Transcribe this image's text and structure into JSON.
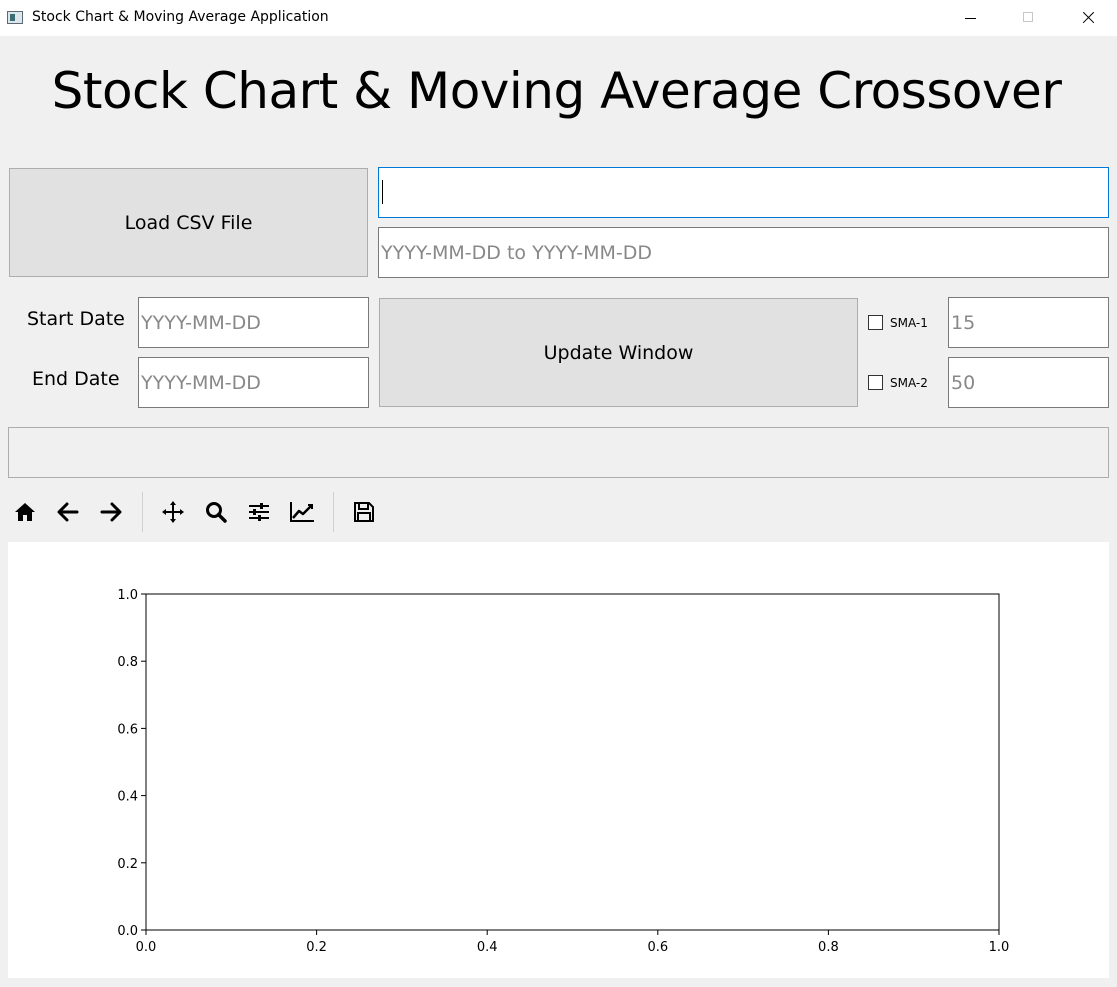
{
  "window": {
    "title": "Stock Chart & Moving Average Application"
  },
  "heading": "Stock Chart & Moving Average Crossover",
  "load_button_label": "Load CSV File",
  "file_path_input": {
    "value": "",
    "placeholder": ""
  },
  "date_range_input": {
    "value": "",
    "placeholder": "YYYY-MM-DD to YYYY-MM-DD"
  },
  "start_date": {
    "label": "Start Date",
    "placeholder": "YYYY-MM-DD",
    "value": ""
  },
  "end_date": {
    "label": "End Date",
    "placeholder": "YYYY-MM-DD",
    "value": ""
  },
  "update_button_label": "Update Window",
  "sma1": {
    "label": "SMA-1",
    "checked": false,
    "placeholder": "15",
    "value": ""
  },
  "sma2": {
    "label": "SMA-2",
    "checked": false,
    "placeholder": "50",
    "value": ""
  },
  "status_text": "",
  "toolbar": {
    "items": [
      {
        "name": "home-icon"
      },
      {
        "name": "back-arrow-icon"
      },
      {
        "name": "forward-arrow-icon"
      },
      {
        "name": "pan-icon"
      },
      {
        "name": "zoom-icon"
      },
      {
        "name": "configure-subplots-icon"
      },
      {
        "name": "edit-axis-icon"
      },
      {
        "name": "save-icon"
      }
    ]
  },
  "chart_data": {
    "type": "line",
    "series": [],
    "xlim": [
      0.0,
      1.0
    ],
    "ylim": [
      0.0,
      1.0
    ],
    "xticks": [
      "0.0",
      "0.2",
      "0.4",
      "0.6",
      "0.8",
      "1.0"
    ],
    "yticks": [
      "0.0",
      "0.2",
      "0.4",
      "0.6",
      "0.8",
      "1.0"
    ],
    "grid": false
  }
}
